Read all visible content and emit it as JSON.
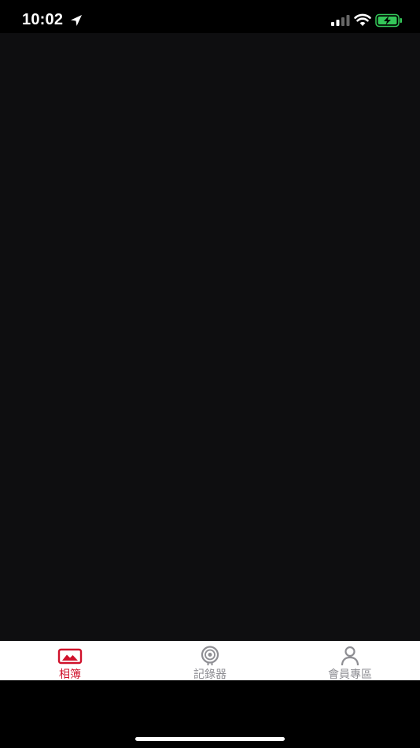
{
  "status_bar": {
    "time": "10:02",
    "icons": [
      "location-arrow-icon",
      "cellular-signal-icon",
      "wifi-icon",
      "battery-charging-icon"
    ]
  },
  "tab_bar": {
    "tabs": [
      {
        "label": "相簿",
        "icon": "photo-album-icon",
        "active": true
      },
      {
        "label": "記錄器",
        "icon": "dashcam-icon",
        "active": false
      },
      {
        "label": "會員專區",
        "icon": "member-profile-icon",
        "active": false
      }
    ]
  },
  "colors": {
    "accent": "#d0112b",
    "inactive": "#8e8e93",
    "content_background": "#0e0e10",
    "tab_bar_background": "#ffffff",
    "battery_fill": "#34c759"
  }
}
